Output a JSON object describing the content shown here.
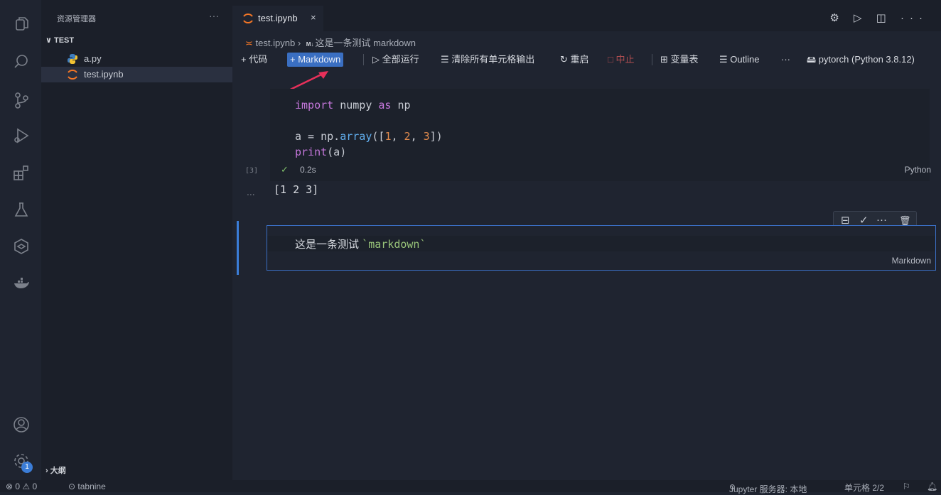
{
  "sidebar": {
    "title": "资源管理器",
    "more": "···",
    "section": "TEST",
    "files": [
      {
        "name": "a.py"
      },
      {
        "name": "test.ipynb"
      }
    ],
    "outline": "大纲"
  },
  "tab": {
    "label": "test.ipynb",
    "close": "×"
  },
  "title_actions": "⚙ ▷ ◫ ···",
  "breadcrumb": {
    "file": "test.ipynb",
    "sep": "›",
    "m4": "M↓",
    "section": "这是一条测试 markdown"
  },
  "toolbar": {
    "add_code": "+ 代码",
    "add_markdown": "+ Markdown",
    "run_all": "▷ 全部运行",
    "clear_outputs": "☰ 清除所有单元格输出",
    "restart": "↻ 重启",
    "interrupt": "□ 中止",
    "variables": "⊞ 变量表",
    "outline": "☰ Outline",
    "more": "···",
    "kernel": "pytorch (Python 3.8.12)"
  },
  "cell1": {
    "line1": [
      "import",
      " numpy ",
      "as",
      " np"
    ],
    "line2a": "a = np.",
    "line2b": "array",
    "line2c": "([",
    "n1": "1",
    "c1": ", ",
    "n2": "2",
    "c2": ", ",
    "n3": "3",
    "line2d": "])",
    "line3a": "print",
    "line3b": "(a)",
    "exec_count": "[3]",
    "status_check": "✓",
    "duration": "0.2s",
    "language": "Python",
    "output_dots": "...",
    "output": "[1 2 3]"
  },
  "cell2": {
    "text_before": "这是一条测试 ",
    "code": "`markdown`",
    "language": "Markdown",
    "tools": [
      "⊟",
      "✓",
      "···",
      "🗑"
    ]
  },
  "status": {
    "problems": "⊗ 0 ⚠ 0",
    "tabnine": "⊙ tabnine",
    "jupyter": "Jupyter 服务器: 本地",
    "cell_pos": "单元格 2/2"
  },
  "colors": {
    "accent": "#3b7dd8",
    "annotation_arrow": "#e8305a"
  }
}
